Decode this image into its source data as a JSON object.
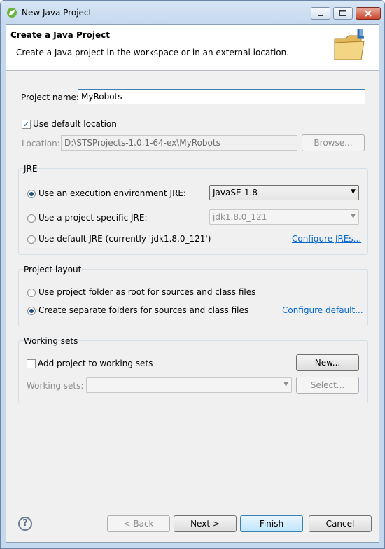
{
  "window": {
    "title": "New Java Project",
    "icon": "spring-leaf-icon"
  },
  "banner": {
    "title": "Create a Java Project",
    "description": "Create a Java project in the workspace or in an external location.",
    "image": "new-folder-icon"
  },
  "project": {
    "name_label": "Project name:",
    "name_value": "MyRobots"
  },
  "location": {
    "use_default_label": "Use default location",
    "use_default_checked": true,
    "label": "Location:",
    "value": "D:\\STSProjects-1.0.1-64-ex\\MyRobots",
    "browse_label": "Browse..."
  },
  "jre": {
    "group_title": "JRE",
    "option_env_label": "Use an execution environment JRE:",
    "option_env_value": "JavaSE-1.8",
    "option_specific_label": "Use a project specific JRE:",
    "option_specific_value": "jdk1.8.0_121",
    "option_default_label": "Use default JRE (currently 'jdk1.8.0_121')",
    "configure_link": "Configure JREs...",
    "selected": "env"
  },
  "layout": {
    "group_title": "Project layout",
    "option_root_label": "Use project folder as root for sources and class files",
    "option_separate_label": "Create separate folders for sources and class files",
    "configure_link": "Configure default...",
    "selected": "separate"
  },
  "working_sets": {
    "group_title": "Working sets",
    "add_label": "Add project to working sets",
    "add_checked": false,
    "new_label": "New...",
    "sets_label": "Working sets:",
    "sets_value": "",
    "select_label": "Select..."
  },
  "footer": {
    "back_label": "< Back",
    "next_label": "Next >",
    "finish_label": "Finish",
    "cancel_label": "Cancel"
  },
  "colors": {
    "link": "#0066cc",
    "accent": "#3c7fb1",
    "radio_dot": "#1c5180"
  }
}
